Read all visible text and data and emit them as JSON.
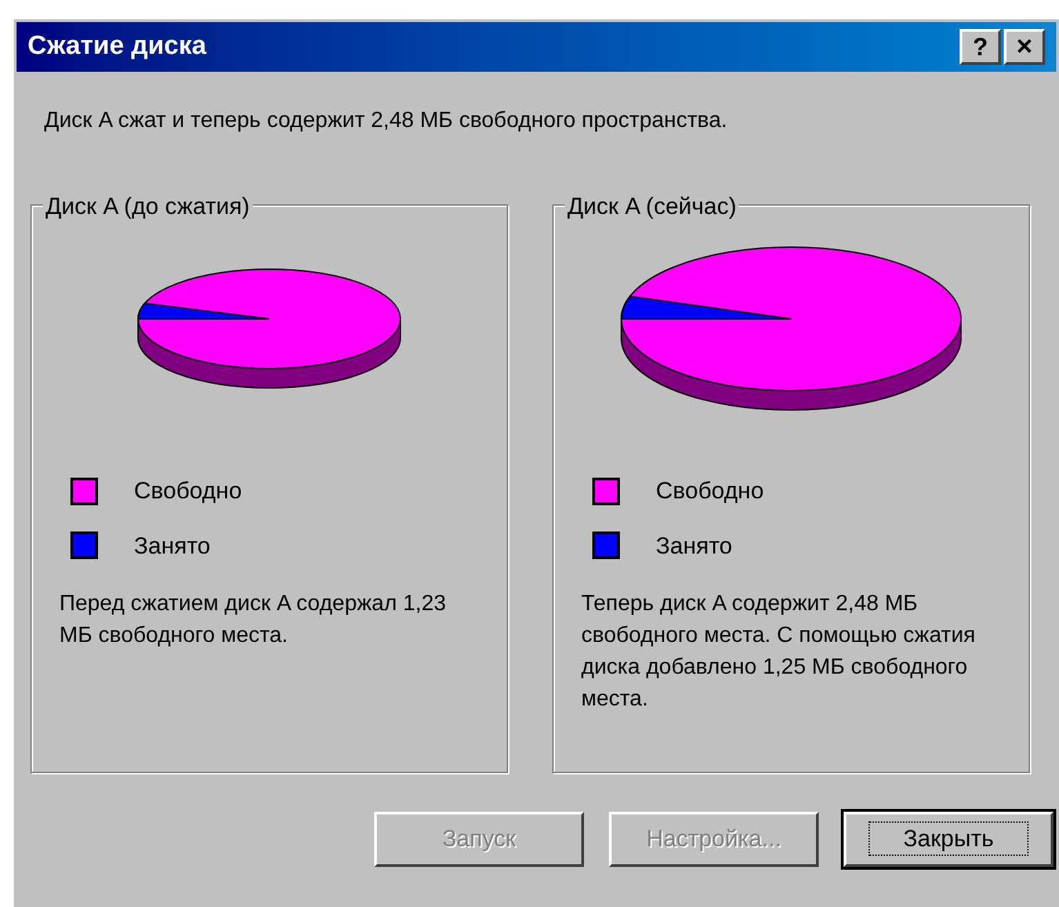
{
  "window": {
    "title": "Сжатие диска",
    "help_button": "?",
    "close_button": "×"
  },
  "message": "Диск A сжат и теперь содержит 2,48 МБ свободного пространства.",
  "groups": [
    {
      "title": "Диск A (до сжатия)",
      "legend": [
        {
          "label": "Свободно",
          "color": "#ff00ff"
        },
        {
          "label": "Занято",
          "color": "#0000ff"
        }
      ],
      "description": "Перед сжатием диск A содержал 1,23 МБ свободного места."
    },
    {
      "title": "Диск A (сейчас)",
      "legend": [
        {
          "label": "Свободно",
          "color": "#ff00ff"
        },
        {
          "label": "Занято",
          "color": "#0000ff"
        }
      ],
      "description": "Теперь диск A содержит 2,48 МБ свободного места. С помощью сжатия диска добавлено 1,25 МБ свободного места."
    }
  ],
  "buttons": [
    {
      "label": "Запуск",
      "disabled": true,
      "default": false
    },
    {
      "label": "Настройка...",
      "disabled": true,
      "default": false
    },
    {
      "label": "Закрыть",
      "disabled": false,
      "default": true
    }
  ]
}
